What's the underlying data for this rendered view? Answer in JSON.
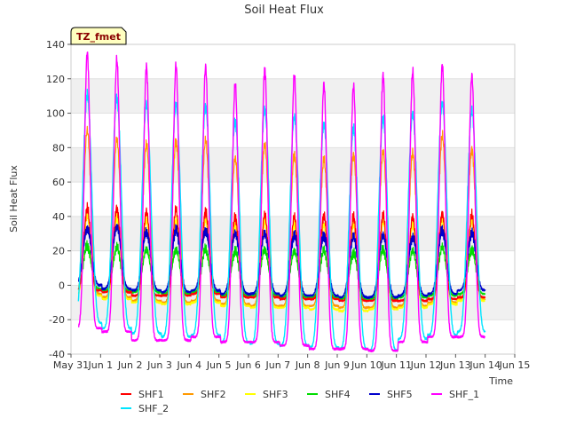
{
  "chart_data": {
    "type": "line",
    "title": "Soil Heat Flux",
    "xlabel": "Time",
    "ylabel": "Soil Heat Flux",
    "annotation": "TZ_fmet",
    "xlim": [
      0,
      15
    ],
    "ylim": [
      -40,
      140
    ],
    "yticks": [
      -40,
      -20,
      0,
      20,
      40,
      60,
      80,
      100,
      120,
      140
    ],
    "xtick_labels": [
      "May 31",
      "Jun 1",
      "Jun 2",
      "Jun 3",
      "Jun 4",
      "Jun 5",
      "Jun 6",
      "Jun 7",
      "Jun 8",
      "Jun 9",
      "Jun 10",
      "Jun 11",
      "Jun 12",
      "Jun 13",
      "Jun 14",
      "Jun 15"
    ],
    "x_start": 0.25,
    "x_end": 14.0,
    "peak_offset": 0.55,
    "grid": "horizontal bands",
    "legend_position": "bottom",
    "series": [
      {
        "name": "SHF1",
        "color": "#ff0000",
        "sharp": 4.0,
        "width": 1.2,
        "peaks": [
          45,
          45,
          43,
          44,
          43,
          40,
          41,
          40,
          41,
          40,
          41,
          40,
          42,
          41
        ],
        "troughs": [
          -3,
          -4,
          -6,
          -6,
          -5,
          -7,
          -7,
          -8,
          -8,
          -9,
          -9,
          -9,
          -8,
          -7
        ]
      },
      {
        "name": "SHF2",
        "color": "#ff9900",
        "sharp": 3.5,
        "width": 1.2,
        "peaks": [
          90,
          85,
          82,
          84,
          84,
          74,
          82,
          76,
          73,
          76,
          78,
          77,
          87,
          79
        ],
        "troughs": [
          -5,
          -7,
          -9,
          -10,
          -9,
          -11,
          -12,
          -12,
          -12,
          -13,
          -13,
          -12,
          -10,
          -8
        ]
      },
      {
        "name": "SHF3",
        "color": "#ffff00",
        "sharp": 3.5,
        "width": 1.2,
        "peaks": [
          40,
          40,
          38,
          38,
          38,
          36,
          37,
          36,
          35,
          36,
          37,
          36,
          38,
          37
        ],
        "troughs": [
          -6,
          -8,
          -10,
          -11,
          -10,
          -12,
          -13,
          -13,
          -14,
          -15,
          -14,
          -13,
          -11,
          -9
        ]
      },
      {
        "name": "SHF4",
        "color": "#00dd00",
        "sharp": 3.0,
        "width": 1.2,
        "peaks": [
          23,
          22,
          21,
          21,
          21,
          20,
          21,
          20,
          20,
          19,
          21,
          20,
          22,
          21
        ],
        "troughs": [
          -2,
          -3,
          -4,
          -5,
          -4,
          -6,
          -6,
          -7,
          -7,
          -8,
          -8,
          -7,
          -6,
          -5
        ]
      },
      {
        "name": "SHF5",
        "color": "#0000cc",
        "sharp": 2.5,
        "width": 1.4,
        "peaks": [
          33,
          34,
          31,
          32,
          32,
          30,
          30,
          29,
          29,
          28,
          29,
          28,
          32,
          30
        ],
        "troughs": [
          0,
          -2,
          -3,
          -4,
          -3,
          -5,
          -5,
          -6,
          -6,
          -7,
          -7,
          -6,
          -5,
          -3
        ]
      },
      {
        "name": "SHF_1",
        "color": "#ff00ff",
        "sharp": 5.0,
        "width": 1.4,
        "peaks": [
          135,
          131,
          127,
          128,
          127,
          117,
          126,
          122,
          117,
          116,
          122,
          124,
          128,
          122
        ],
        "troughs": [
          -25,
          -27,
          -32,
          -32,
          -30,
          -33,
          -33,
          -35,
          -37,
          -37,
          -38,
          -33,
          -30,
          -30
        ]
      },
      {
        "name": "SHF_2",
        "color": "#00e5ff",
        "sharp": 2.2,
        "width": 1.4,
        "peaks": [
          111,
          109,
          105,
          105,
          104,
          95,
          102,
          98,
          94,
          91,
          97,
          100,
          106,
          101
        ],
        "troughs": [
          -22,
          -25,
          -28,
          -30,
          -29,
          -33,
          -34,
          -35,
          -36,
          -37,
          -38,
          -31,
          -29,
          -27
        ]
      }
    ]
  }
}
